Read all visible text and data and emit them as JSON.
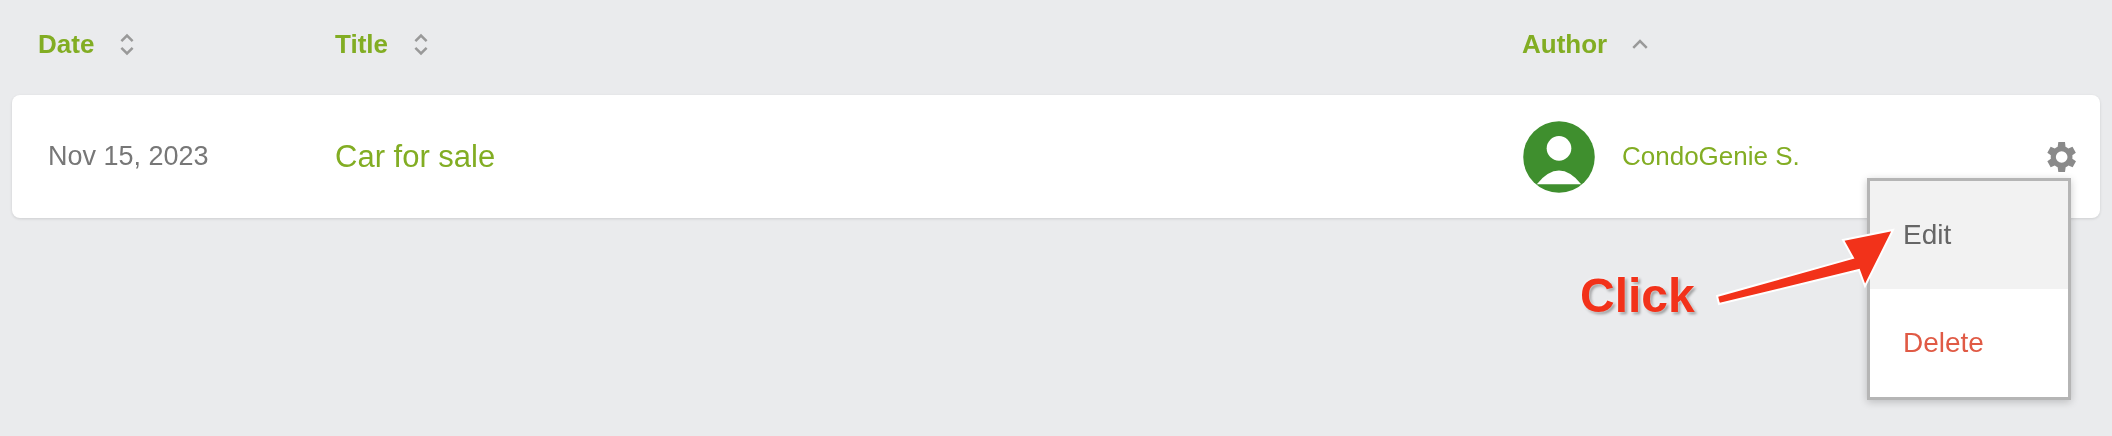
{
  "columns": [
    {
      "label": "Date",
      "sorted": false
    },
    {
      "label": "Title",
      "sorted": false
    },
    {
      "label": "Author",
      "sorted": true
    }
  ],
  "rows": [
    {
      "date": "Nov 15, 2023",
      "title": "Car for sale",
      "author": "CondoGenie S."
    }
  ],
  "menu": {
    "items": [
      {
        "label": "Edit",
        "kind": "normal",
        "selected": true
      },
      {
        "label": "Delete",
        "kind": "danger",
        "selected": false
      }
    ]
  },
  "annotation": {
    "text": "Click"
  }
}
